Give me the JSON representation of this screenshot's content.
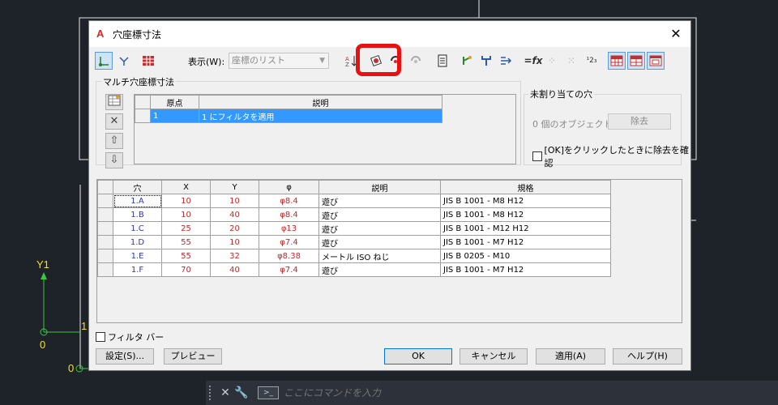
{
  "dialog": {
    "title": "穴座標寸法",
    "close_label": "✕"
  },
  "toolbar": {
    "display_label": "表示(W):",
    "display_value": "座標のリスト",
    "icons": [
      "origin-icon",
      "axis-icon",
      "grid-icon",
      "sort-icon",
      "add-description-icon",
      "hole-icon",
      "hole-gray-icon",
      "report-icon",
      "attach-icon",
      "branch-icon",
      "arrow-right-icon",
      "formula-icon",
      "dots-icon",
      "sequence-icon",
      "numbering-icon",
      "table-red-icon",
      "table-red-2-icon",
      "table-frame-icon"
    ]
  },
  "multi": {
    "group_label": "マルチ穴座標寸法",
    "columns": [
      "原点",
      "説明"
    ],
    "rows": [
      {
        "origin": "1",
        "desc": "1 にフィルタを適用"
      }
    ]
  },
  "unassigned": {
    "group_label": "未割り当ての穴",
    "count_text": "0 個のオブジェクト",
    "remove_label": "除去",
    "confirm_label": "[OK]をクリックしたときに除去を確認"
  },
  "holes": {
    "columns": [
      "穴",
      "X",
      "Y",
      "φ",
      "説明",
      "規格"
    ],
    "rows": [
      {
        "hole": "1.A",
        "x": "10",
        "y": "10",
        "phi": "φ8.4",
        "desc": "遊び",
        "std": "JIS B 1001 - M8  H12"
      },
      {
        "hole": "1.B",
        "x": "10",
        "y": "40",
        "phi": "φ8.4",
        "desc": "遊び",
        "std": "JIS B 1001 - M8  H12"
      },
      {
        "hole": "1.C",
        "x": "25",
        "y": "20",
        "phi": "φ13",
        "desc": "遊び",
        "std": "JIS B 1001 - M12  H12"
      },
      {
        "hole": "1.D",
        "x": "55",
        "y": "10",
        "phi": "φ7.4",
        "desc": "遊び",
        "std": "JIS B 1001 - M7  H12"
      },
      {
        "hole": "1.E",
        "x": "55",
        "y": "32",
        "phi": "φ8.38",
        "desc": "メートル ISO ねじ",
        "std": "JIS B 0205 - M10"
      },
      {
        "hole": "1.F",
        "x": "70",
        "y": "40",
        "phi": "φ7.4",
        "desc": "遊び",
        "std": "JIS B 1001 - M7  H12"
      }
    ]
  },
  "footer": {
    "filter_bar_label": "フィルタ バー",
    "settings_label": "設定(S)...",
    "preview_label": "プレビュー",
    "ok_label": "OK",
    "cancel_label": "キャンセル",
    "apply_label": "適用(A)",
    "help_label": "ヘルプ(H)"
  },
  "cad": {
    "axis_y_label": "Y1",
    "axis_origin_1": "0",
    "axis_origin_0": "0",
    "axis_one": "1",
    "command_placeholder": "ここにコマンドを入力"
  },
  "colors": {
    "highlight": "#e81010",
    "cad_background": "#1e2229",
    "axis": "#f2e02a"
  }
}
